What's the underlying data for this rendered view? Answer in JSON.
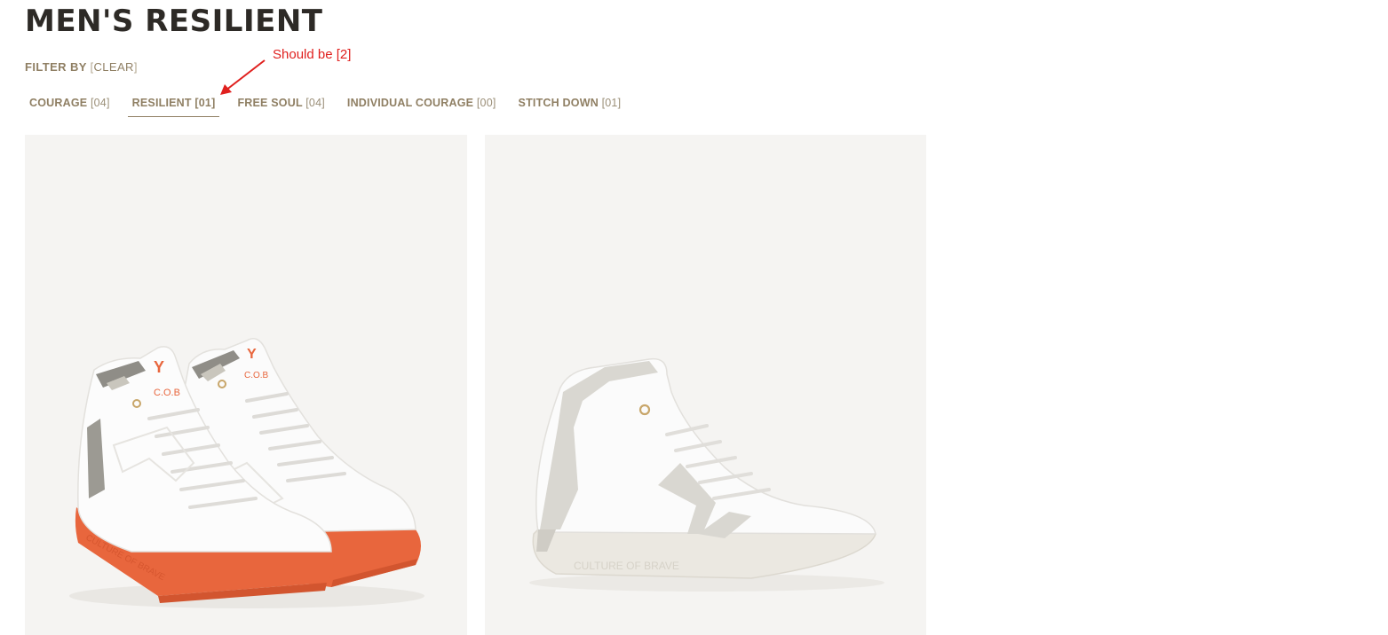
{
  "page": {
    "title": "MEN'S RESILIENT"
  },
  "filter": {
    "label": "FILTER BY",
    "clear_label": "CLEAR"
  },
  "tabs": [
    {
      "label": "COURAGE",
      "count": "[04]",
      "active": false
    },
    {
      "label": "RESILIENT",
      "count": "[01]",
      "active": true
    },
    {
      "label": "FREE SOUL",
      "count": "[04]",
      "active": false
    },
    {
      "label": "INDIVIDUAL COURAGE",
      "count": "[00]",
      "active": false
    },
    {
      "label": "STITCH DOWN",
      "count": "[01]",
      "active": false
    }
  ],
  "annotation": {
    "text": "Should be [2]",
    "color": "#e0201e"
  },
  "products": [
    {
      "image": "white-high-top-sneakers-orange-sole-pair",
      "sole_text": "CULTURE OF BRAVE",
      "tongue_text": "C.O.B",
      "sole_color": "#e8663d"
    },
    {
      "image": "white-high-top-sneaker-grey-suede-single",
      "sole_text": "CULTURE OF BRAVE",
      "sole_color": "#ebe8e1"
    }
  ],
  "colors": {
    "title": "#2d2a26",
    "accent": "#8f7f63",
    "tile_bg": "#f5f4f2"
  }
}
